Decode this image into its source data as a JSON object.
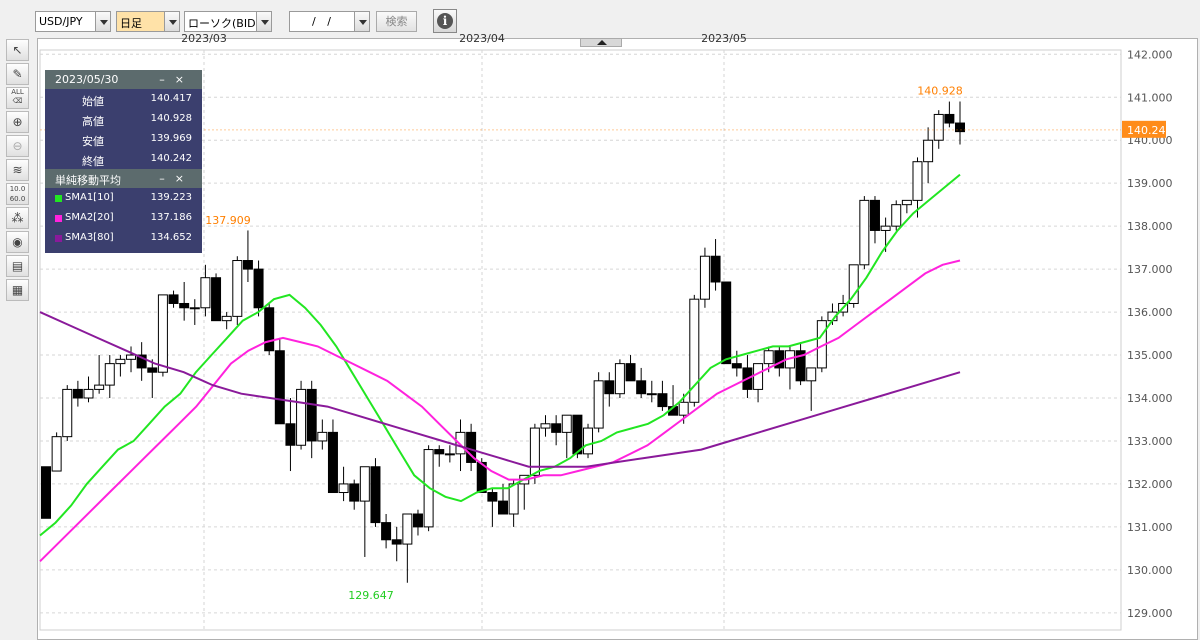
{
  "toolbar": {
    "pair": "USD/JPY",
    "timeframe": "日足",
    "chart_type": "ローソク(BID)",
    "date_value": "/ /",
    "search_label": "検索",
    "info_icon": "info-icon"
  },
  "tools": [
    "cursor-icon",
    "pencil-icon",
    "erase-all-icon",
    "zoom-in-icon",
    "zoom-out-icon",
    "indicator-icon",
    "numeric-icon",
    "shapes-icon",
    "eye-icon",
    "print-icon",
    "table-icon"
  ],
  "panel": {
    "date": "2023/05/30",
    "rows": [
      {
        "label": "始値",
        "value": "140.417"
      },
      {
        "label": "高値",
        "value": "140.928"
      },
      {
        "label": "安値",
        "value": "139.969"
      },
      {
        "label": "終値",
        "value": "140.242"
      }
    ],
    "sma_title": "単純移動平均",
    "sma": [
      {
        "label": "SMA1[10]",
        "value": "139.223",
        "color": "#22e622"
      },
      {
        "label": "SMA2[20]",
        "value": "137.186",
        "color": "#ff22dd"
      },
      {
        "label": "SMA3[80]",
        "value": "134.652",
        "color": "#8a1a9a"
      }
    ]
  },
  "chart_data": {
    "type": "line",
    "x_labels": [
      "2023/03",
      "2023/04",
      "2023/05"
    ],
    "y_ticks": [
      "142.000",
      "141.000",
      "140.000",
      "139.000",
      "138.000",
      "137.000",
      "136.000",
      "135.000",
      "134.000",
      "133.000",
      "132.000",
      "131.000",
      "130.000",
      "129.000"
    ],
    "ylim": [
      128.6,
      142.1
    ],
    "current_price": "140.242",
    "annotations": [
      {
        "text": "140.928",
        "value": 140.928,
        "color": "#ff7f00",
        "kind": "high"
      },
      {
        "text": "137.909",
        "value": 137.909,
        "color": "#ff7f00",
        "kind": "high"
      },
      {
        "text": "129.647",
        "value": 129.647,
        "color": "#22cc22",
        "kind": "low"
      }
    ],
    "candles": [
      [
        132.4,
        132.3,
        131.2,
        131.2
      ],
      [
        132.3,
        133.2,
        132.3,
        133.1
      ],
      [
        133.1,
        134.3,
        133.0,
        134.2
      ],
      [
        134.2,
        134.4,
        133.8,
        134.0
      ],
      [
        134.0,
        134.5,
        133.9,
        134.2
      ],
      [
        134.2,
        135.0,
        134.1,
        134.3
      ],
      [
        134.3,
        135.0,
        134.0,
        134.8
      ],
      [
        134.8,
        135.0,
        134.5,
        134.9
      ],
      [
        134.9,
        135.2,
        134.6,
        135.0
      ],
      [
        135.0,
        135.3,
        134.4,
        134.7
      ],
      [
        134.7,
        134.9,
        134.0,
        134.6
      ],
      [
        134.6,
        136.4,
        134.5,
        136.4
      ],
      [
        136.4,
        136.5,
        136.1,
        136.2
      ],
      [
        136.2,
        136.7,
        135.8,
        136.1
      ],
      [
        136.1,
        136.3,
        135.7,
        136.1
      ],
      [
        136.1,
        137.1,
        135.9,
        136.8
      ],
      [
        136.8,
        136.9,
        135.8,
        135.8
      ],
      [
        135.8,
        136.0,
        135.6,
        135.9
      ],
      [
        135.9,
        137.3,
        135.7,
        137.2
      ],
      [
        137.2,
        137.9,
        136.7,
        137.0
      ],
      [
        137.0,
        137.2,
        135.9,
        136.1
      ],
      [
        136.1,
        136.2,
        135.0,
        135.1
      ],
      [
        135.1,
        135.4,
        134.0,
        133.4
      ],
      [
        133.4,
        134.0,
        132.3,
        132.9
      ],
      [
        132.9,
        134.4,
        132.8,
        134.2
      ],
      [
        134.2,
        134.4,
        132.6,
        133.0
      ],
      [
        133.0,
        133.5,
        132.8,
        133.2
      ],
      [
        133.2,
        133.5,
        131.8,
        131.8
      ],
      [
        131.8,
        132.4,
        131.6,
        132.0
      ],
      [
        132.0,
        132.1,
        131.4,
        131.6
      ],
      [
        131.6,
        131.9,
        130.3,
        132.4
      ],
      [
        132.4,
        132.6,
        131.0,
        131.1
      ],
      [
        131.1,
        131.3,
        130.5,
        130.7
      ],
      [
        130.7,
        131.0,
        130.2,
        130.6
      ],
      [
        130.6,
        131.1,
        129.7,
        131.3
      ],
      [
        131.3,
        131.4,
        130.8,
        131.0
      ],
      [
        131.0,
        132.9,
        130.9,
        132.8
      ],
      [
        132.8,
        132.9,
        132.4,
        132.7
      ],
      [
        132.7,
        132.9,
        132.5,
        132.7
      ],
      [
        132.7,
        133.5,
        132.3,
        133.2
      ],
      [
        133.2,
        133.4,
        132.3,
        132.5
      ],
      [
        132.5,
        132.6,
        131.8,
        131.8
      ],
      [
        131.8,
        131.9,
        131.0,
        131.6
      ],
      [
        131.6,
        132.0,
        131.3,
        131.3
      ],
      [
        131.3,
        132.1,
        131.0,
        132.0
      ],
      [
        132.0,
        132.2,
        131.4,
        132.2
      ],
      [
        132.2,
        133.4,
        132.0,
        133.3
      ],
      [
        133.3,
        133.6,
        133.1,
        133.4
      ],
      [
        133.4,
        133.6,
        132.9,
        133.2
      ],
      [
        133.2,
        133.5,
        132.6,
        133.6
      ],
      [
        133.6,
        133.6,
        132.6,
        132.7
      ],
      [
        132.7,
        133.4,
        132.6,
        133.3
      ],
      [
        133.3,
        134.6,
        133.2,
        134.4
      ],
      [
        134.4,
        134.6,
        133.8,
        134.1
      ],
      [
        134.1,
        134.9,
        134.0,
        134.8
      ],
      [
        134.8,
        135.0,
        134.4,
        134.4
      ],
      [
        134.4,
        134.7,
        134.0,
        134.1
      ],
      [
        134.1,
        134.4,
        133.9,
        134.1
      ],
      [
        134.1,
        134.4,
        133.7,
        133.8
      ],
      [
        133.8,
        134.3,
        133.6,
        133.6
      ],
      [
        133.6,
        134.1,
        133.4,
        133.9
      ],
      [
        133.9,
        136.4,
        133.8,
        136.3
      ],
      [
        136.3,
        137.5,
        136.1,
        137.3
      ],
      [
        137.3,
        137.7,
        136.5,
        136.7
      ],
      [
        136.7,
        136.7,
        134.8,
        134.8
      ],
      [
        134.8,
        135.1,
        134.5,
        134.7
      ],
      [
        134.7,
        135.0,
        134.0,
        134.2
      ],
      [
        134.2,
        134.8,
        133.9,
        134.8
      ],
      [
        134.8,
        135.2,
        134.6,
        135.1
      ],
      [
        135.1,
        135.2,
        134.5,
        134.7
      ],
      [
        134.7,
        135.2,
        134.2,
        135.1
      ],
      [
        135.1,
        135.3,
        134.3,
        134.4
      ],
      [
        134.4,
        134.5,
        133.7,
        134.7
      ],
      [
        134.7,
        135.9,
        134.6,
        135.8
      ],
      [
        135.8,
        136.2,
        135.7,
        136.0
      ],
      [
        136.0,
        136.4,
        135.9,
        136.2
      ],
      [
        136.2,
        137.0,
        136.1,
        137.1
      ],
      [
        137.1,
        138.7,
        137.0,
        138.6
      ],
      [
        138.6,
        138.7,
        137.6,
        137.9
      ],
      [
        137.9,
        138.2,
        137.4,
        138.0
      ],
      [
        138.0,
        138.6,
        137.9,
        138.5
      ],
      [
        138.5,
        138.6,
        138.3,
        138.6
      ],
      [
        138.6,
        139.6,
        138.2,
        139.5
      ],
      [
        139.5,
        140.3,
        139.0,
        140.0
      ],
      [
        140.0,
        140.7,
        139.8,
        140.6
      ],
      [
        140.6,
        140.9,
        140.3,
        140.4
      ],
      [
        140.4,
        140.9,
        139.9,
        140.2
      ]
    ],
    "series": [
      {
        "name": "SMA1[10]",
        "color": "#22e622",
        "values": [
          130.8,
          131.1,
          131.5,
          132.0,
          132.4,
          132.8,
          133.0,
          133.4,
          133.8,
          134.1,
          134.6,
          135.0,
          135.4,
          135.8,
          136.0,
          136.3,
          136.4,
          136.1,
          135.7,
          135.2,
          134.6,
          134.0,
          133.4,
          132.8,
          132.2,
          131.9,
          131.7,
          131.6,
          131.8,
          131.9,
          131.9,
          132.1,
          132.3,
          132.4,
          132.6,
          132.9,
          133.0,
          133.2,
          133.3,
          133.4,
          133.6,
          133.9,
          134.3,
          134.7,
          134.9,
          135.0,
          135.1,
          135.2,
          135.2,
          135.3,
          135.4,
          135.9,
          136.3,
          136.8,
          137.4,
          137.9,
          138.3,
          138.6,
          138.9,
          139.2
        ]
      },
      {
        "name": "SMA2[20]",
        "color": "#ff22dd",
        "values": [
          130.2,
          130.6,
          131.0,
          131.4,
          131.8,
          132.2,
          132.6,
          133.0,
          133.4,
          133.8,
          134.3,
          134.8,
          135.1,
          135.3,
          135.4,
          135.3,
          135.2,
          135.0,
          134.8,
          134.6,
          134.4,
          134.1,
          133.8,
          133.4,
          133.0,
          132.6,
          132.3,
          132.1,
          132.1,
          132.2,
          132.2,
          132.3,
          132.4,
          132.5,
          132.7,
          132.9,
          133.2,
          133.5,
          133.8,
          134.1,
          134.3,
          134.5,
          134.7,
          134.9,
          135.0,
          135.2,
          135.4,
          135.7,
          136.0,
          136.3,
          136.6,
          136.9,
          137.1,
          137.2
        ]
      },
      {
        "name": "SMA3[80]",
        "color": "#8a1a9a",
        "values": [
          136.0,
          135.7,
          135.4,
          135.1,
          134.8,
          134.6,
          134.3,
          134.1,
          134.0,
          133.9,
          133.8,
          133.6,
          133.4,
          133.2,
          133.0,
          132.8,
          132.6,
          132.4,
          132.4,
          132.4,
          132.5,
          132.6,
          132.7,
          132.8,
          133.0,
          133.2,
          133.4,
          133.6,
          133.8,
          134.0,
          134.2,
          134.4,
          134.6
        ]
      }
    ]
  }
}
